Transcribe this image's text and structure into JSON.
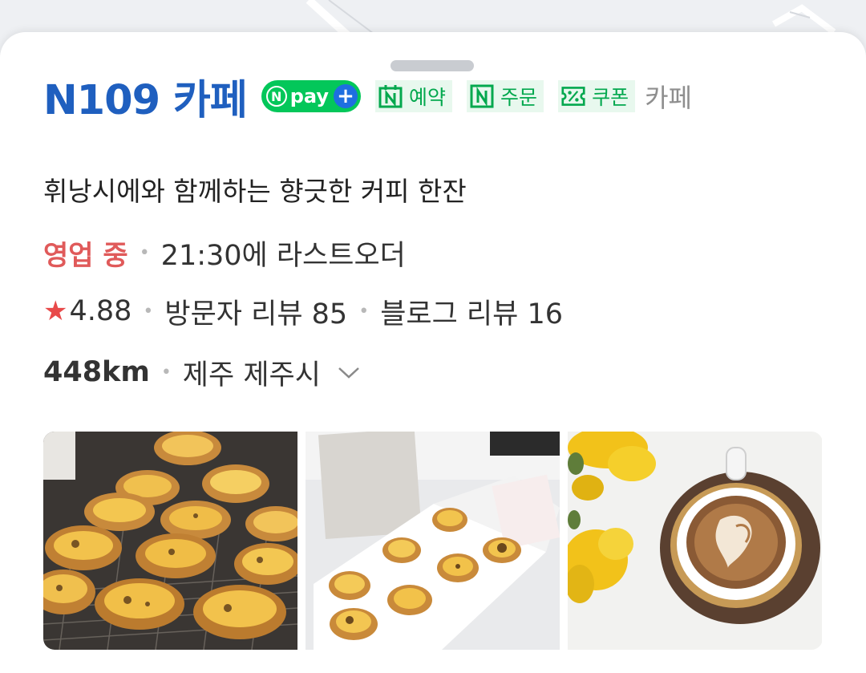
{
  "place": {
    "name": "N109 카페",
    "npay": {
      "label": "pay"
    },
    "badges": [
      {
        "label": "예약",
        "icon": "calendar-n-icon"
      },
      {
        "label": "주문",
        "icon": "n-square-icon"
      },
      {
        "label": "쿠폰",
        "icon": "coupon-percent-icon"
      }
    ],
    "category": "카페",
    "description": "휘낭시에와 함께하는 향긋한 커피 한잔",
    "status": "영업 중",
    "last_order": "21:30에 라스트오더",
    "rating": "4.88",
    "visitor_reviews": "방문자 리뷰 85",
    "blog_reviews": "블로그 리뷰 16",
    "distance": "448km",
    "address": "제주 제주시"
  },
  "photos": [
    {
      "icon": "egg-tart-tray-photo"
    },
    {
      "icon": "egg-tart-box-photo"
    },
    {
      "icon": "latte-photo"
    }
  ],
  "colors": {
    "brand_blue": "#1f5fbf",
    "naver_green": "#03c75a",
    "open_red": "#e05a5a",
    "star_red": "#e84a4a"
  }
}
